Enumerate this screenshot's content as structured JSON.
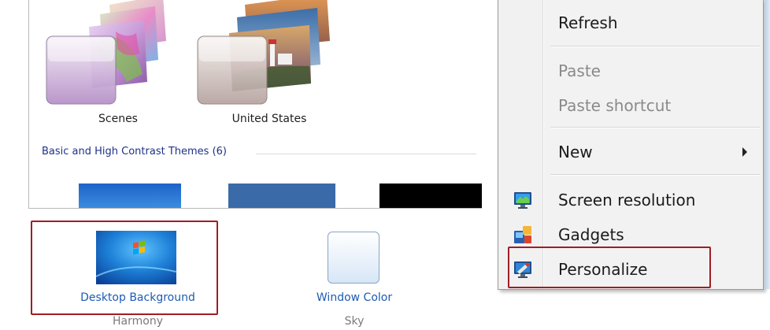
{
  "themes": {
    "items": [
      {
        "label": "Scenes"
      },
      {
        "label": "United States"
      }
    ],
    "basic_section_header": "Basic and High Contrast Themes (6)"
  },
  "bottom_bar": {
    "desktop_background": {
      "label": "Desktop Background",
      "sub": "Harmony"
    },
    "window_color": {
      "label": "Window Color",
      "sub": "Sky"
    }
  },
  "context_menu": {
    "refresh": "Refresh",
    "paste": "Paste",
    "paste_shortcut": "Paste shortcut",
    "new": "New",
    "screen_resolution": "Screen resolution",
    "gadgets": "Gadgets",
    "personalize": "Personalize"
  },
  "colors": {
    "highlight_border": "#a01d24",
    "link_blue": "#1d5bb3",
    "section_header_blue": "#1e3287",
    "menu_background": "#f2f2f2"
  }
}
